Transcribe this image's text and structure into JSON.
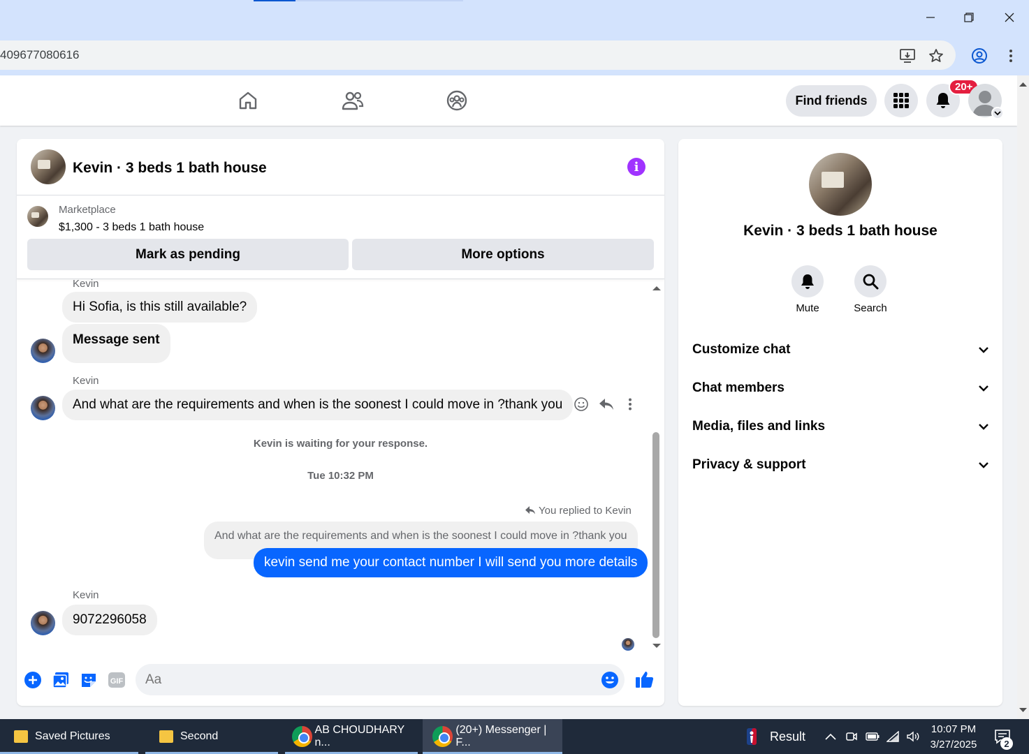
{
  "browser": {
    "url": "409677080616",
    "colors": {
      "frame": "#d3e3fd"
    }
  },
  "fb_nav": {
    "find_friends": "Find friends",
    "notification_count": "20+",
    "icons": [
      "home-icon",
      "friends-icon",
      "groups-icon"
    ]
  },
  "chat": {
    "title": "Kevin · 3 beds 1 bath house",
    "marketplace": {
      "label": "Marketplace",
      "listing": "$1,300 - 3 beds 1 bath house",
      "mark_pending": "Mark as pending",
      "more_options": "More options"
    },
    "messages": {
      "m1_sender": "Kevin",
      "m1_text": "Hi Sofia, is this still available?",
      "m2_text": "Message sent",
      "m3_sender": "Kevin",
      "m3_text": "And what are the requirements and when is the soonest I could move in ?thank you",
      "waiting_note": "Kevin is waiting for your response.",
      "timestamp": "Tue 10:32 PM",
      "reply_label": "You replied to Kevin",
      "quoted_text": "And what are the requirements and when is the soonest I could move in ?thank you",
      "my_reply": "kevin send me your contact number I will send you more details",
      "m4_sender": "Kevin",
      "m4_text": "9072296058"
    },
    "composer": {
      "placeholder": "Aa"
    },
    "colors": {
      "accent": "#0866ff",
      "info": "#a033ff"
    }
  },
  "info_panel": {
    "title": "Kevin · 3 beds 1 bath house",
    "actions": [
      {
        "label": "Mute",
        "icon": "bell-icon"
      },
      {
        "label": "Search",
        "icon": "search-icon"
      }
    ],
    "sections": [
      "Customize chat",
      "Chat members",
      "Media, files and links",
      "Privacy & support"
    ]
  },
  "taskbar": {
    "items": [
      "Saved Pictures",
      "Second",
      "AB CHOUDHARY n...",
      "(20+) Messenger | F..."
    ],
    "news": "Result",
    "time": "10:07 PM",
    "date": "3/27/2025",
    "notif_count": "2"
  }
}
